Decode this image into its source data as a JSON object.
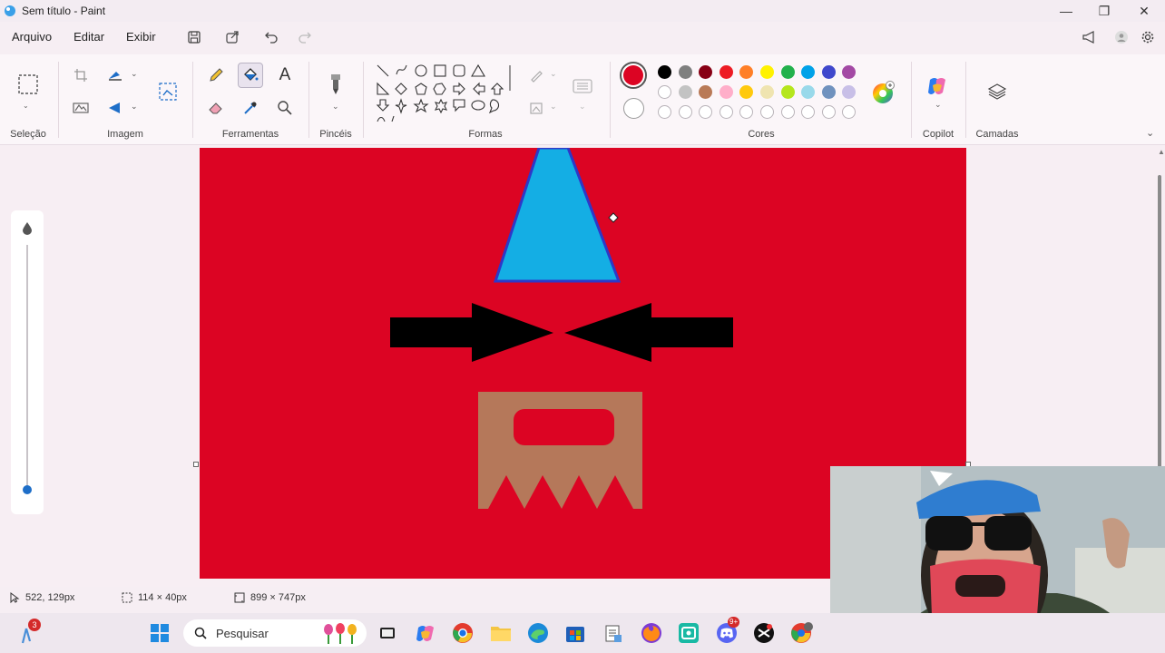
{
  "window": {
    "title": "Sem título - Paint"
  },
  "menu": {
    "file": "Arquivo",
    "edit": "Editar",
    "view": "Exibir"
  },
  "ribbon": {
    "groups": {
      "selection": "Seleção",
      "image": "Imagem",
      "tools": "Ferramentas",
      "brushes": "Pincéis",
      "shapes": "Formas",
      "colors": "Cores",
      "copilot": "Copilot",
      "layers": "Camadas"
    },
    "text_tool_glyph": "A",
    "active_tool": "fill-bucket",
    "primary_color": "#dc0423",
    "secondary_color": "#ffffff",
    "palette": [
      "#000000",
      "#7f7f7f",
      "#880015",
      "#ed1c24",
      "#ff7f27",
      "#fff200",
      "#22b14c",
      "#00a2e8",
      "#3f48cc",
      "#a349a4",
      "#ffffff",
      "#c3c3c3",
      "#b97a57",
      "#ffaec9",
      "#ffc90e",
      "#efe4b0",
      "#b5e61d",
      "#99d9ea",
      "#7092be",
      "#c8bfe7"
    ]
  },
  "canvas": {
    "background_color": "#dc0423",
    "shapes": {
      "hat": {
        "fill": "#14aee4",
        "stroke": "#2e38c8"
      },
      "arrows": {
        "fill": "#000000"
      },
      "beard": {
        "fill": "#b5785a"
      },
      "mouth": {
        "fill": "#dc0423"
      }
    }
  },
  "zoom": {
    "level": 1.0
  },
  "status": {
    "cursor_position": "522, 129px",
    "selection_size": "114 × 40px",
    "canvas_size": "899 × 747px"
  },
  "taskbar": {
    "search_placeholder": "Pesquisar",
    "notification_count": "3",
    "badge_9plus": "9+"
  }
}
